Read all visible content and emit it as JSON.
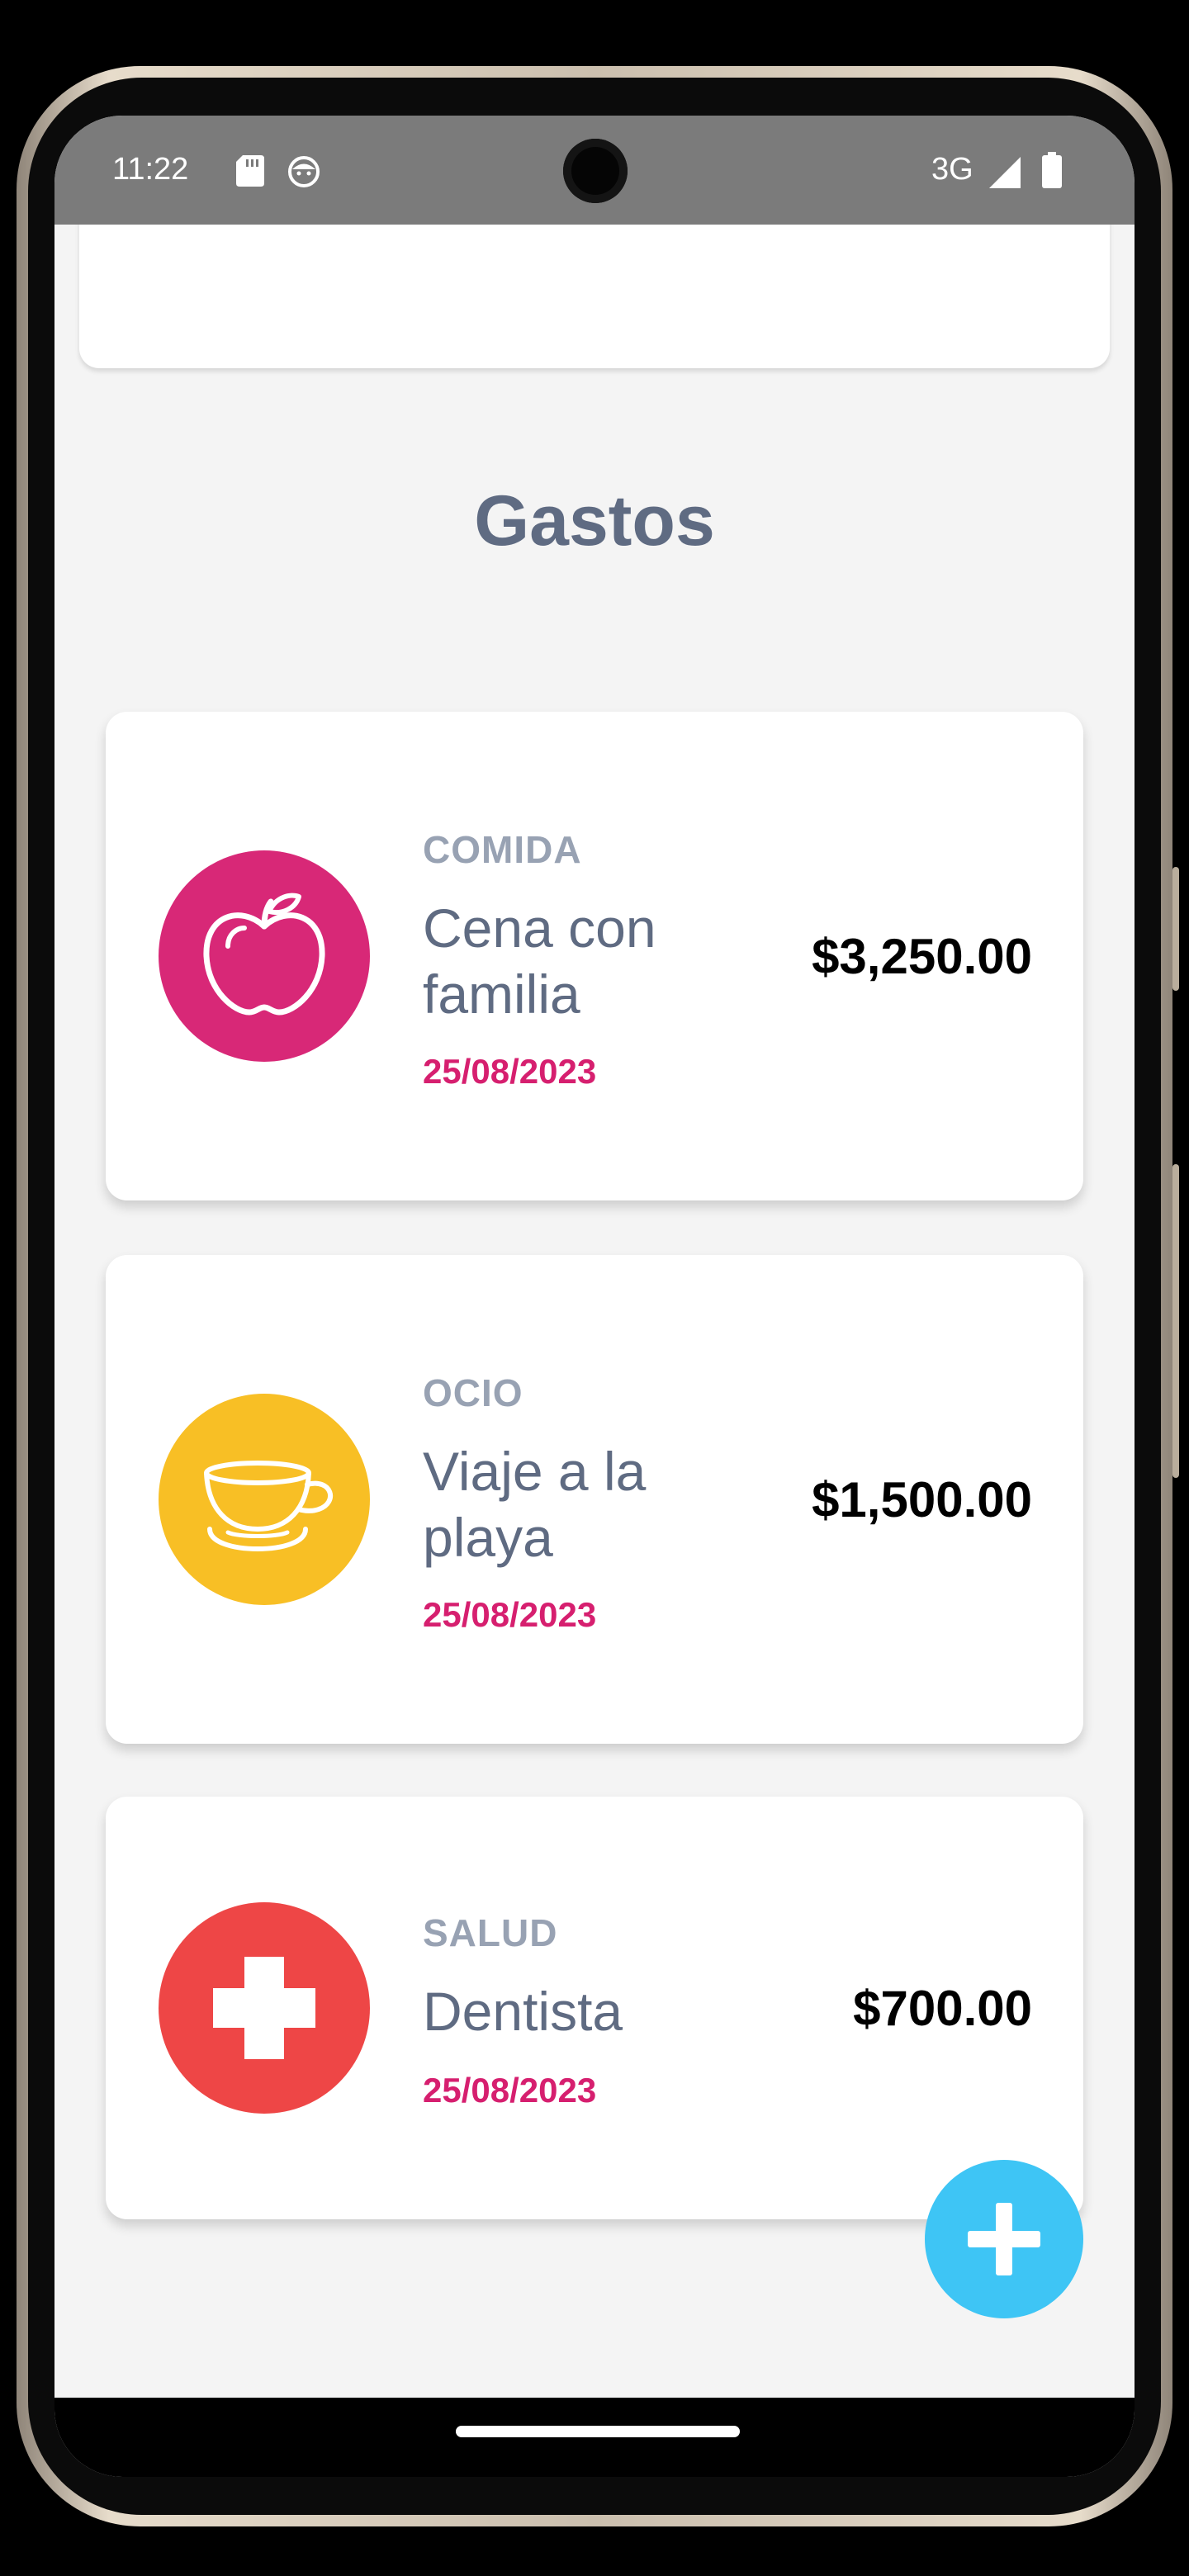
{
  "status_bar": {
    "time": "11:22",
    "network": "3G",
    "icons": [
      "sd-card-icon",
      "face-icon",
      "signal-icon",
      "battery-icon"
    ]
  },
  "page": {
    "title": "Gastos"
  },
  "colors": {
    "title": "#5f6b82",
    "category_label": "#98a2b3",
    "date": "#d61f6f",
    "fab": "#3ec5f5"
  },
  "expenses": [
    {
      "category": "COMIDA",
      "description": "Cena con familia",
      "date": "25/08/2023",
      "amount": "$3,250.00",
      "icon": "apple-icon",
      "color": "#d82877"
    },
    {
      "category": "OCIO",
      "description": "Viaje a la playa",
      "date": "25/08/2023",
      "amount": "$1,500.00",
      "icon": "cup-icon",
      "color": "#f8bf25"
    },
    {
      "category": "SALUD",
      "description": "Dentista",
      "date": "25/08/2023",
      "amount": "$700.00",
      "icon": "medical-cross-icon",
      "color": "#ee4646"
    }
  ],
  "fab": {
    "icon": "plus-icon"
  }
}
